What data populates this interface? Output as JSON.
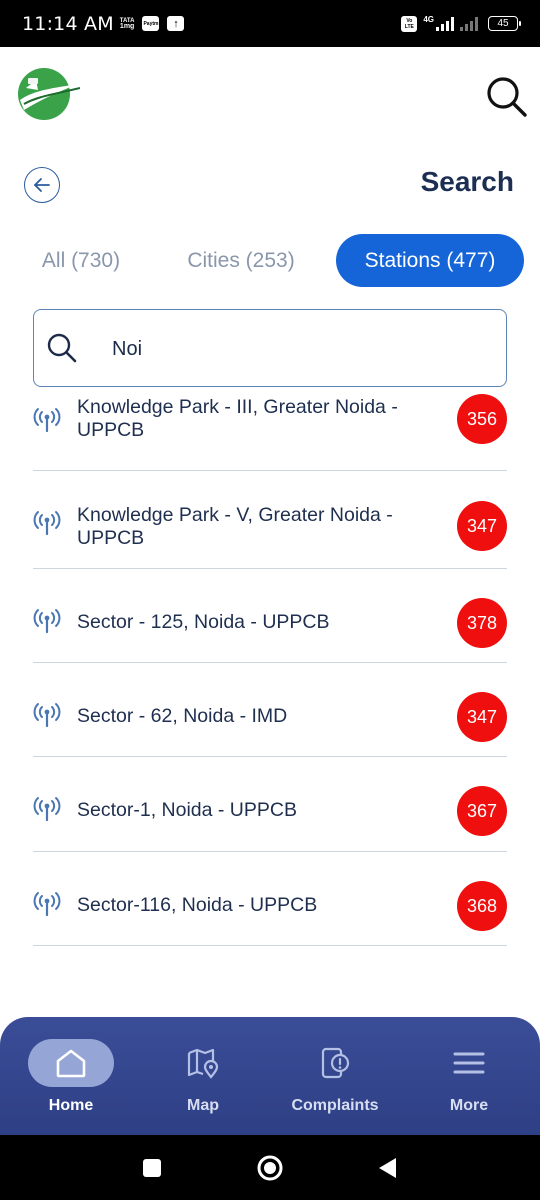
{
  "status_bar": {
    "time": "11:14 AM",
    "carrier_top": "TATA",
    "carrier_bottom": "1mg",
    "paytm": "Paytm",
    "volte_top": "Vo",
    "volte_bottom": "LTE",
    "network": "4G",
    "battery": "45"
  },
  "header": {
    "logo_icon": "sameer-app-logo",
    "search_icon": "search-icon",
    "back_icon": "back-arrow-icon",
    "title": "Search"
  },
  "tabs": [
    {
      "label": "All (730)",
      "active": false
    },
    {
      "label": "Cities (253)",
      "active": false
    },
    {
      "label": "Stations (477)",
      "active": true
    }
  ],
  "search": {
    "value": "Noi",
    "placeholder": ""
  },
  "results": [
    {
      "name": "Knowledge Park - III, Greater Noida - UPPCB",
      "aqi": "356"
    },
    {
      "name": "Knowledge Park - V, Greater Noida - UPPCB",
      "aqi": "347"
    },
    {
      "name": "Sector - 125, Noida - UPPCB",
      "aqi": "378"
    },
    {
      "name": "Sector - 62, Noida - IMD",
      "aqi": "347"
    },
    {
      "name": "Sector-1, Noida - UPPCB",
      "aqi": "367"
    },
    {
      "name": "Sector-116, Noida - UPPCB",
      "aqi": "368"
    }
  ],
  "bottom_nav": [
    {
      "label": "Home",
      "icon": "home-icon",
      "active": true
    },
    {
      "label": "Map",
      "icon": "map-pin-icon",
      "active": false
    },
    {
      "label": "Complaints",
      "icon": "complaint-icon",
      "active": false
    },
    {
      "label": "More",
      "icon": "menu-icon",
      "active": false
    }
  ],
  "colors": {
    "accent": "#1565d8",
    "aqi_severe": "#ef0f0f",
    "nav_bg": "#3a4d97",
    "title_text": "#1c2e52"
  }
}
